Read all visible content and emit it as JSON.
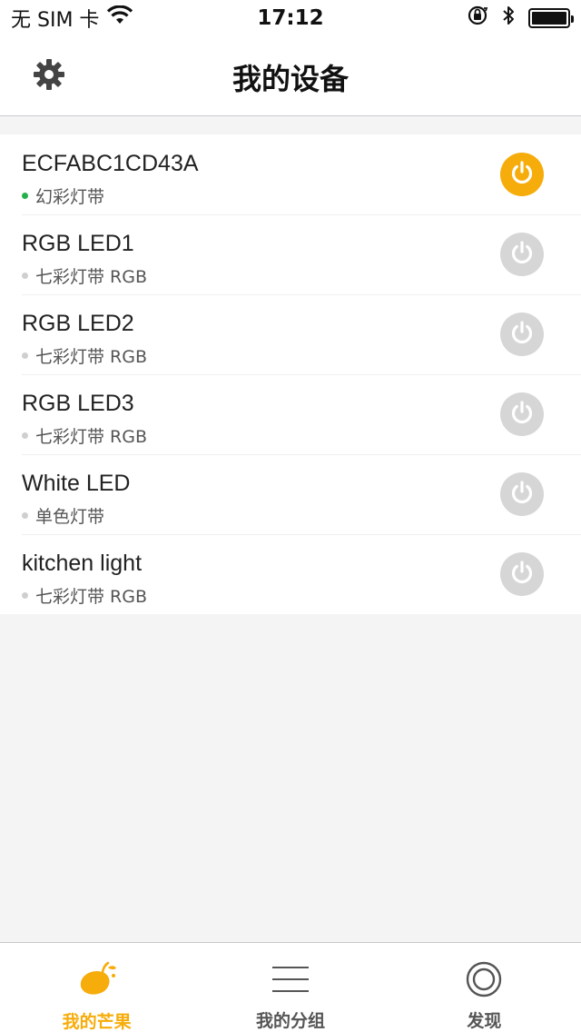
{
  "status_bar": {
    "carrier": "无 SIM 卡",
    "time": "17:12",
    "icons": [
      "wifi-icon",
      "orientation-lock-icon",
      "bluetooth-icon",
      "battery-icon"
    ]
  },
  "header": {
    "title": "我的设备",
    "settings_icon": "gear-icon"
  },
  "devices": [
    {
      "name": "ECFABC1CD43A",
      "type": "幻彩灯带",
      "online": true,
      "power_on": true
    },
    {
      "name": "RGB LED1",
      "type": "七彩灯带 RGB",
      "online": false,
      "power_on": false
    },
    {
      "name": "RGB LED2",
      "type": "七彩灯带 RGB",
      "online": false,
      "power_on": false
    },
    {
      "name": "RGB LED3",
      "type": "七彩灯带 RGB",
      "online": false,
      "power_on": false
    },
    {
      "name": "White LED",
      "type": "单色灯带",
      "online": false,
      "power_on": false
    },
    {
      "name": "kitchen light",
      "type": "七彩灯带 RGB",
      "online": false,
      "power_on": false
    }
  ],
  "tabs": [
    {
      "label": "我的芒果",
      "icon": "mango-icon",
      "active": true
    },
    {
      "label": "我的分组",
      "icon": "list-icon",
      "active": false
    },
    {
      "label": "发现",
      "icon": "discover-icon",
      "active": false
    }
  ],
  "colors": {
    "accent": "#f6ac0a",
    "online_dot": "#25b14a",
    "power_off": "#d6d6d6",
    "background": "#f4f4f5"
  }
}
